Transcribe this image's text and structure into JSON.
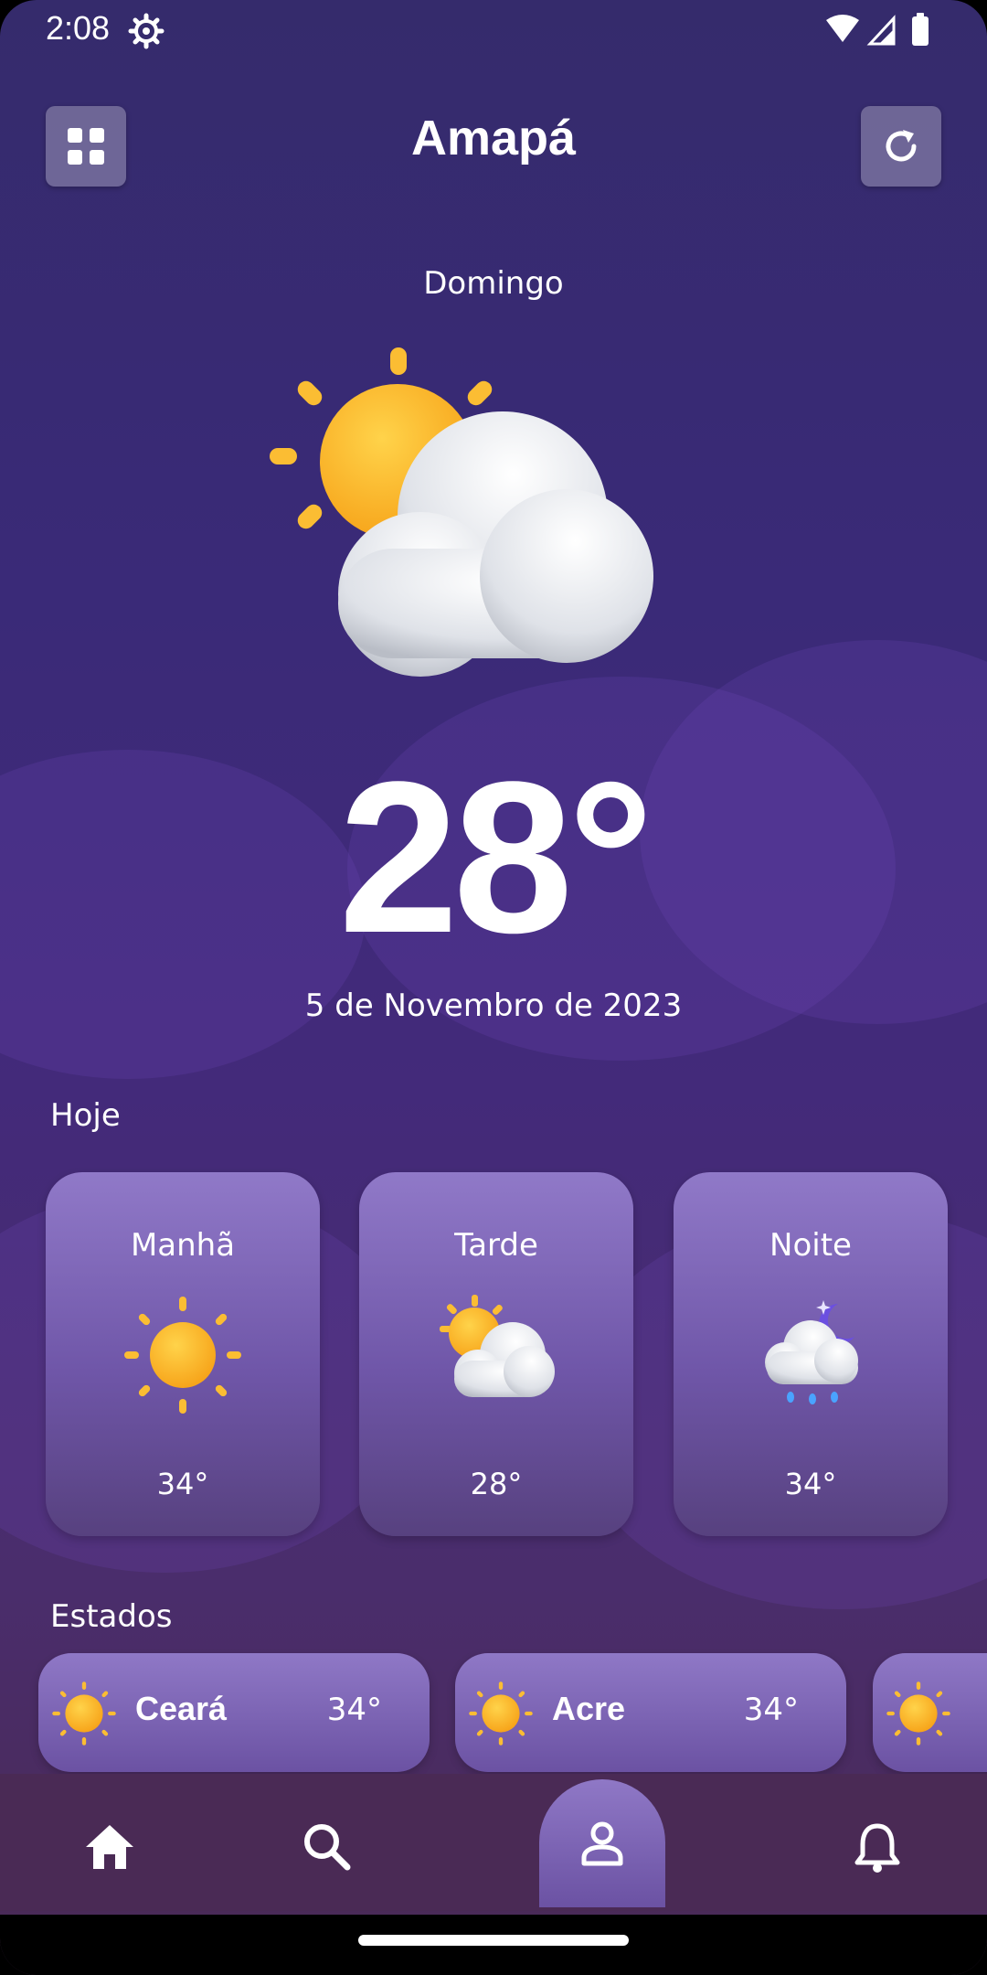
{
  "status_bar": {
    "time": "2:08"
  },
  "header": {
    "city": "Amapá",
    "menu_icon": "grid-icon",
    "refresh_icon": "refresh-icon"
  },
  "current": {
    "day": "Domingo",
    "temperature": "28°",
    "date": "5 de Novembro de 2023",
    "condition_icon": "partly-cloudy-icon"
  },
  "today": {
    "title": "Hoje",
    "periods": [
      {
        "label": "Manhã",
        "temp": "34°",
        "icon": "sun-icon"
      },
      {
        "label": "Tarde",
        "temp": "28°",
        "icon": "partly-cloudy-icon"
      },
      {
        "label": "Noite",
        "temp": "34°",
        "icon": "night-rain-icon"
      }
    ]
  },
  "states": {
    "title": "Estados",
    "items": [
      {
        "name": "Ceará",
        "temp": "34°",
        "icon": "sun-icon"
      },
      {
        "name": "Acre",
        "temp": "34°",
        "icon": "sun-icon"
      },
      {
        "name": "",
        "temp": "",
        "icon": "sun-icon"
      }
    ]
  },
  "nav": {
    "items": [
      {
        "icon": "home-icon"
      },
      {
        "icon": "search-icon"
      },
      {
        "icon": "profile-icon",
        "active": true
      },
      {
        "icon": "bell-icon"
      }
    ]
  },
  "colors": {
    "background": "#3a2a78",
    "card": "#7a62b4",
    "nav": "#4a2a55"
  }
}
